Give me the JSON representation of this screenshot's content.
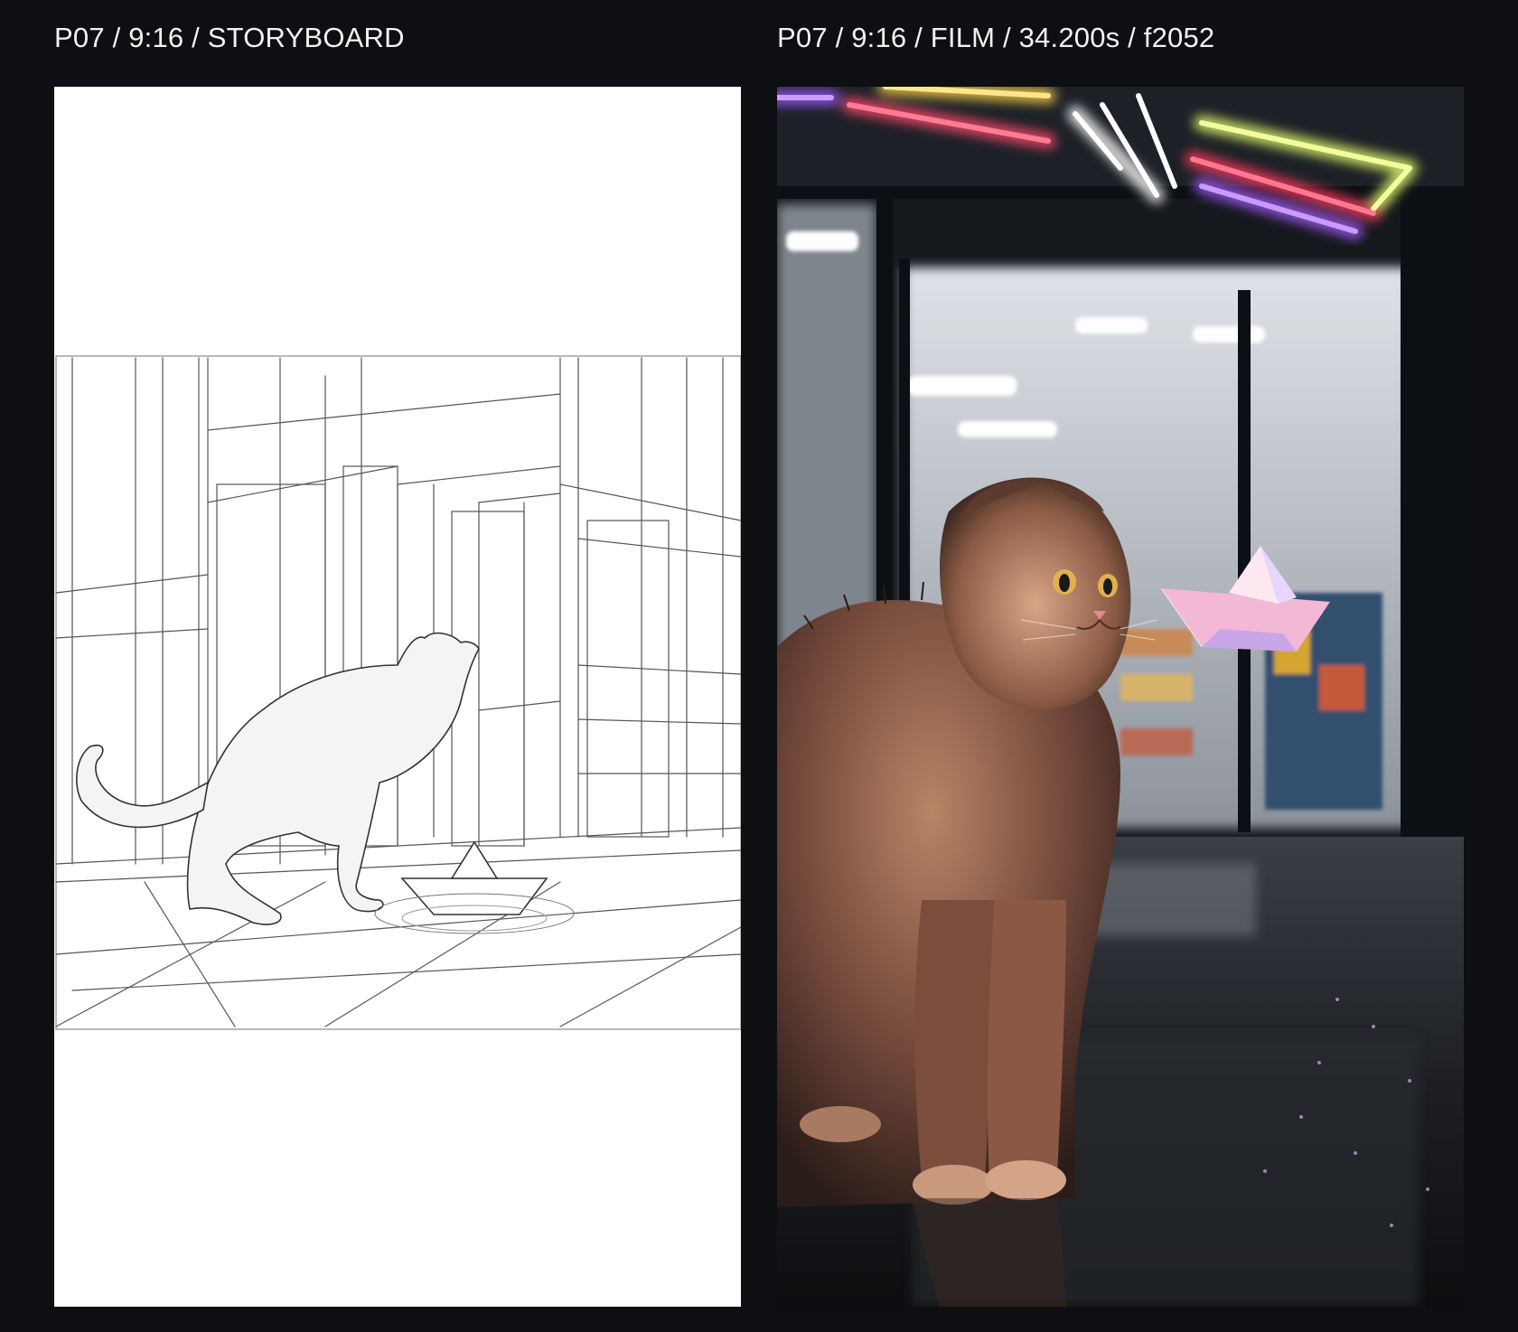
{
  "storyboard": {
    "label": "P07 / 9:16 / STORYBOARD"
  },
  "film": {
    "label": "P07 / 9:16 / FILM / 34.200s / f2052"
  },
  "colors": {
    "background": "#0e0f13",
    "label_text": "#f2f2f2",
    "storyboard_paper": "#ffffff"
  }
}
